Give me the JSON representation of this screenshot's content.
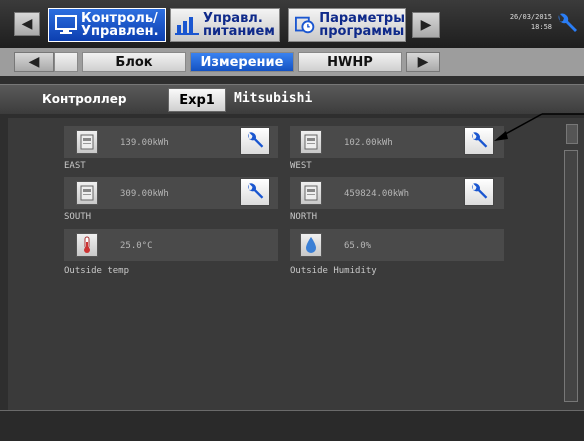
{
  "header": {
    "menu_buttons": [
      {
        "line1": "Контроль/",
        "line2": "Управлен.",
        "active": true,
        "icon": "monitor-icon"
      },
      {
        "line1": "Управл.",
        "line2": "питанием",
        "active": false,
        "icon": "bar-chart-icon"
      },
      {
        "line1": "Параметры",
        "line2": "программы",
        "active": false,
        "icon": "schedule-icon"
      }
    ],
    "date": "26/03/2015",
    "time": "18:58"
  },
  "tabs": [
    {
      "label": "Блок",
      "active": false
    },
    {
      "label": "Измерение",
      "active": true
    },
    {
      "label": "HWHP",
      "active": false
    }
  ],
  "controller": {
    "label": "Контроллер",
    "expander": "Exp1",
    "manufacturer": "Mitsubishi"
  },
  "meters": [
    {
      "value": "139.00kWh",
      "name": "EAST",
      "icon": "meter-icon"
    },
    {
      "value": "102.00kWh",
      "name": "WEST",
      "icon": "meter-icon"
    },
    {
      "value": "309.00kWh",
      "name": "SOUTH",
      "icon": "meter-icon"
    },
    {
      "value": "459824.00kWh",
      "name": "NORTH",
      "icon": "meter-icon"
    },
    {
      "value": "25.0°C",
      "name": "Outside temp",
      "icon": "thermometer-icon"
    },
    {
      "value": "65.0%",
      "name": "Outside Humidity",
      "icon": "humidity-drop-icon"
    }
  ],
  "colors": {
    "accent_blue": "#1a56d0",
    "background": "#3a3a3a"
  }
}
